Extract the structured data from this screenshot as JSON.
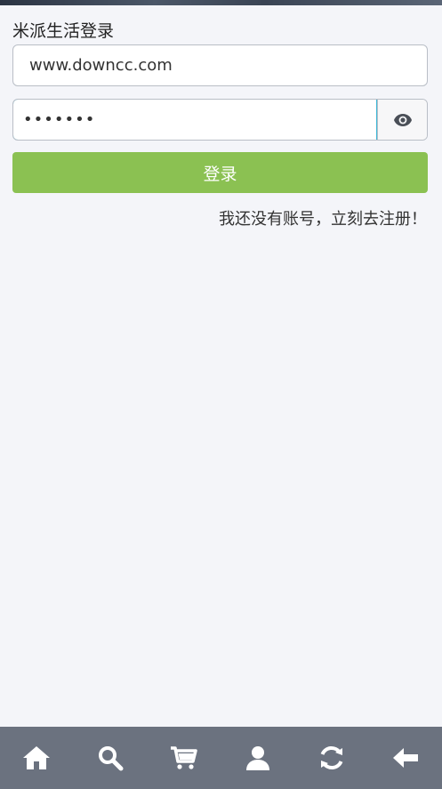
{
  "page": {
    "title": "米派生活登录"
  },
  "login_form": {
    "username_value": "www.downcc.com",
    "password_value": "1234567",
    "login_label": "登录",
    "register_link": "我还没有账号，立刻去注册！"
  },
  "bottom_nav": {
    "items": [
      {
        "icon": "home-icon"
      },
      {
        "icon": "search-icon"
      },
      {
        "icon": "cart-icon"
      },
      {
        "icon": "user-icon"
      },
      {
        "icon": "refresh-icon"
      },
      {
        "icon": "back-arrow-icon"
      }
    ]
  },
  "colors": {
    "background": "#f4f5f9",
    "accent_green": "#8bc152",
    "focus_border": "#3cb7d6",
    "nav_bar": "#6b727f"
  }
}
